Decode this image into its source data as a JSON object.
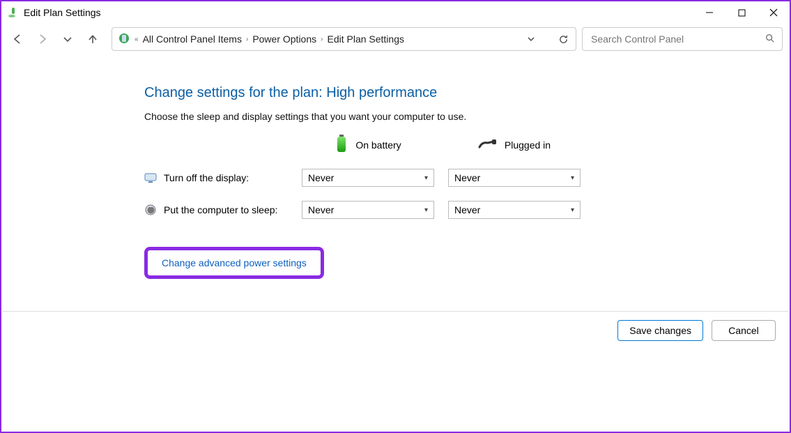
{
  "window": {
    "title": "Edit Plan Settings"
  },
  "breadcrumb": {
    "items": [
      "All Control Panel Items",
      "Power Options",
      "Edit Plan Settings"
    ]
  },
  "search": {
    "placeholder": "Search Control Panel"
  },
  "main": {
    "heading": "Change settings for the plan: High performance",
    "subtext": "Choose the sleep and display settings that you want your computer to use.",
    "columns": {
      "battery_label": "On battery",
      "plugged_label": "Plugged in"
    },
    "rows": [
      {
        "label": "Turn off the display:",
        "battery_value": "Never",
        "plugged_value": "Never"
      },
      {
        "label": "Put the computer to sleep:",
        "battery_value": "Never",
        "plugged_value": "Never"
      }
    ],
    "advanced_link": "Change advanced power settings"
  },
  "footer": {
    "save_label": "Save changes",
    "cancel_label": "Cancel"
  }
}
